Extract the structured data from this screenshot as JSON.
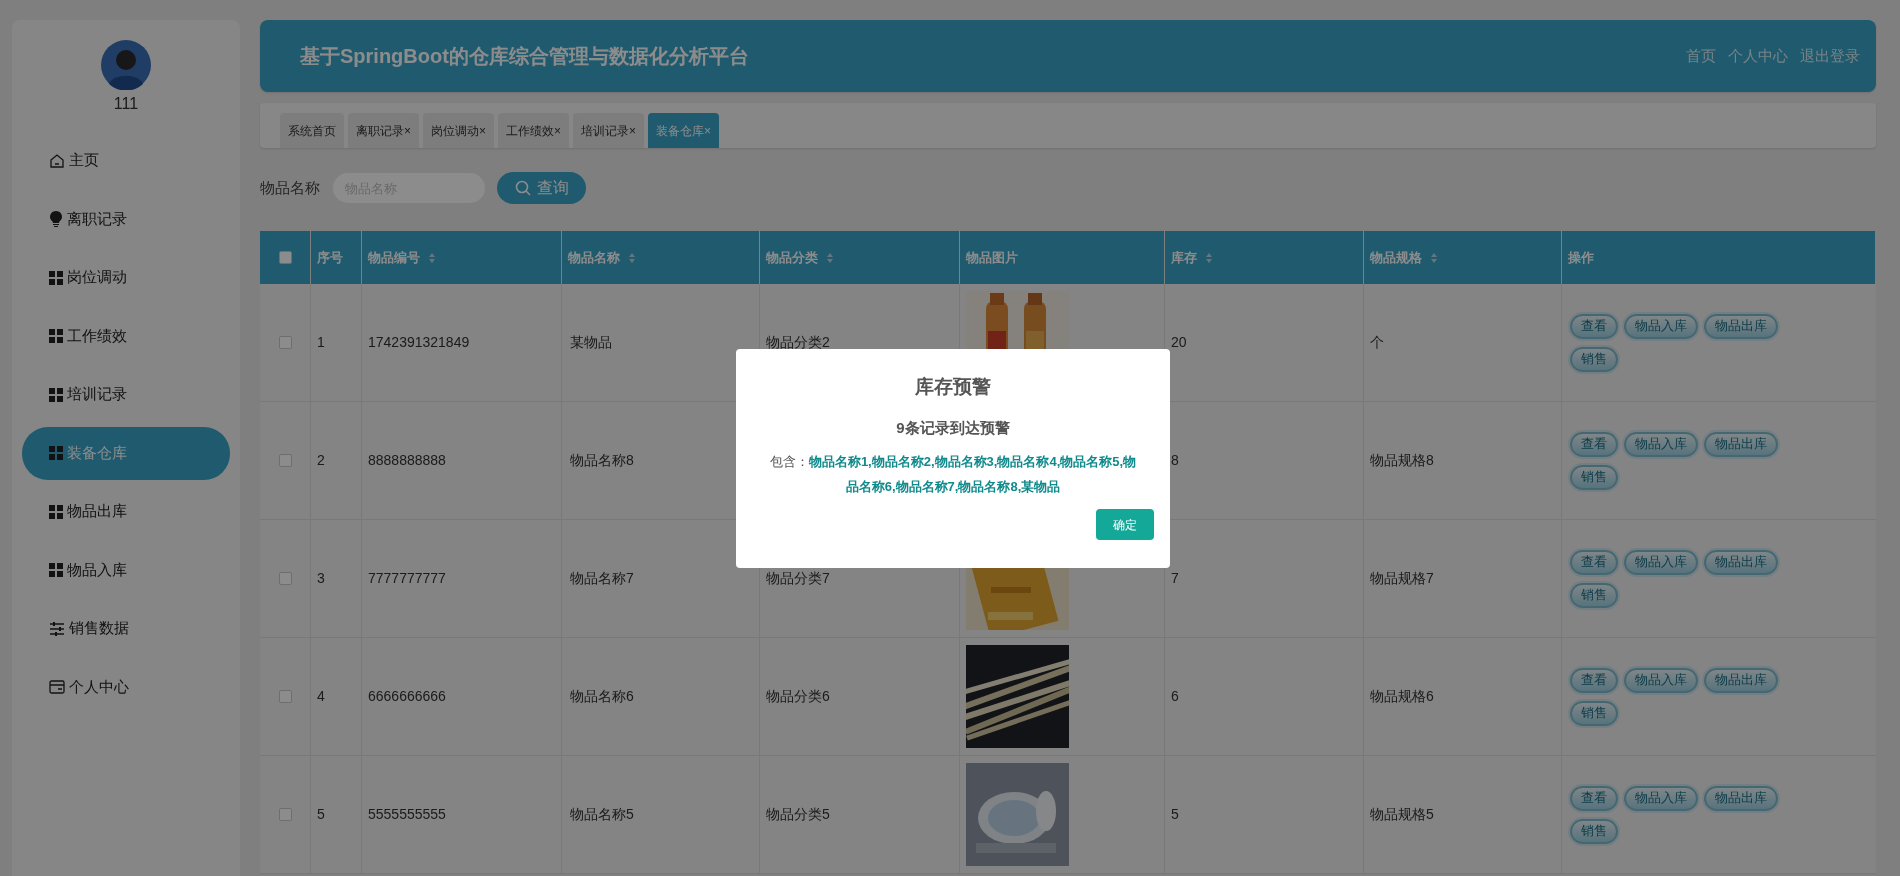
{
  "sidebar": {
    "username": "111",
    "items": [
      {
        "label": "主页",
        "selected": false
      },
      {
        "label": "离职记录",
        "selected": false
      },
      {
        "label": "岗位调动",
        "selected": false
      },
      {
        "label": "工作绩效",
        "selected": false
      },
      {
        "label": "培训记录",
        "selected": false
      },
      {
        "label": "装备仓库",
        "selected": true
      },
      {
        "label": "物品出库",
        "selected": false
      },
      {
        "label": "物品入库",
        "selected": false
      },
      {
        "label": "销售数据",
        "selected": false
      },
      {
        "label": "个人中心",
        "selected": false
      }
    ]
  },
  "header": {
    "title": "基于SpringBoot的仓库综合管理与数据化分析平台",
    "links": [
      "首页",
      "个人中心",
      "退出登录"
    ]
  },
  "tabs": [
    {
      "label": "系统首页",
      "selected": false
    },
    {
      "label": "离职记录",
      "close": "×",
      "selected": false
    },
    {
      "label": "岗位调动",
      "close": "×",
      "selected": false
    },
    {
      "label": "工作绩效",
      "close": "×",
      "selected": false
    },
    {
      "label": "培训记录",
      "close": "×",
      "selected": false
    },
    {
      "label": "装备仓库",
      "close": "×",
      "selected": true
    }
  ],
  "search": {
    "label": "物品名称",
    "placeholder": "物品名称",
    "button": "查询"
  },
  "table": {
    "all_checked": false,
    "columns": [
      {
        "label": "序号",
        "sortable": false
      },
      {
        "label": "物品编号",
        "sortable": true
      },
      {
        "label": "物品名称",
        "sortable": true
      },
      {
        "label": "物品分类",
        "sortable": true
      },
      {
        "label": "物品图片",
        "sortable": false
      },
      {
        "label": "库存",
        "sortable": true
      },
      {
        "label": "物品规格",
        "sortable": true
      },
      {
        "label": "操作",
        "sortable": false
      }
    ],
    "rows": [
      {
        "checked": false,
        "index": "1",
        "code": "1742391321849",
        "name": "某物品",
        "category": "物品分类2",
        "image": {
          "kind": "picture"
        },
        "stock": "20",
        "spec": "个",
        "actions": [
          "查看",
          "物品入库",
          "物品出库",
          "销售"
        ]
      },
      {
        "checked": false,
        "index": "2",
        "code": "8888888888",
        "name": "物品名称8",
        "stock": "8",
        "spec": "物品规格8",
        "actions": [
          "查看",
          "物品入库",
          "物品出库",
          "销售"
        ]
      },
      {
        "checked": false,
        "index": "3",
        "code": "7777777777",
        "name": "物品名称7",
        "category": "物品分类7",
        "image": {
          "kind": "picture"
        },
        "stock": "7",
        "spec": "物品规格7",
        "actions": [
          "查看",
          "物品入库",
          "物品出库",
          "销售"
        ]
      },
      {
        "checked": false,
        "index": "4",
        "code": "6666666666",
        "name": "物品名称6",
        "category": "物品分类6",
        "image": {
          "kind": "picture"
        },
        "stock": "6",
        "spec": "物品规格6",
        "actions": [
          "查看",
          "物品入库",
          "物品出库",
          "销售"
        ]
      },
      {
        "checked": false,
        "index": "5",
        "code": "5555555555",
        "name": "物品名称5",
        "category": "物品分类5",
        "image": {
          "kind": "picture"
        },
        "stock": "5",
        "spec": "物品规格5",
        "actions": [
          "查看",
          "物品入库",
          "物品出库",
          "销售"
        ]
      }
    ]
  },
  "dialog": {
    "title": "库存预警",
    "subtitle": "9条记录到达预警",
    "message": "包含：**物品名称1,物品名称2,物品名称3,物品名称4,物品名称5,物品名称6,物品名称7,物品名称8,某物品**",
    "button": "确定"
  }
}
